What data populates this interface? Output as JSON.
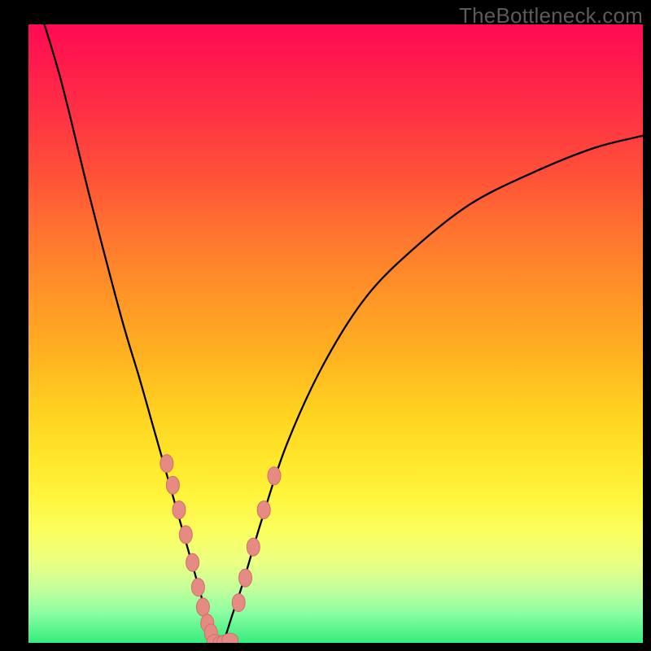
{
  "watermark": "TheBottleneck.com",
  "colors": {
    "frame": "#000000",
    "curve": "#000000",
    "marker_fill": "#e68a84",
    "marker_stroke": "#cf6f69"
  },
  "chart_data": {
    "type": "line",
    "title": "",
    "xlabel": "",
    "ylabel": "",
    "xlim": [
      0,
      100
    ],
    "ylim": [
      0,
      100
    ],
    "grid": false,
    "legend": false,
    "note": "Qualitative bottleneck curve; y is mismatch % (0 at minimum). Values estimated from pixels.",
    "x": [
      0,
      5,
      10,
      15,
      18,
      20,
      22,
      24,
      26,
      28,
      29,
      30,
      31,
      32,
      33,
      35,
      38,
      42,
      48,
      55,
      63,
      72,
      82,
      92,
      100
    ],
    "values": [
      108,
      92,
      72,
      53,
      43,
      36,
      29,
      22,
      15,
      8,
      4,
      1,
      0,
      1,
      4,
      10,
      20,
      32,
      45,
      56,
      64,
      71,
      76,
      80,
      82
    ],
    "markers": {
      "left_branch_x": [
        22.5,
        23.5,
        24.5,
        25.6,
        26.7,
        27.6,
        28.4,
        29.1,
        29.7
      ],
      "left_branch_y": [
        29.0,
        25.5,
        21.5,
        17.5,
        13.0,
        9.0,
        5.8,
        3.2,
        1.6
      ],
      "bottom_x": [
        30.4,
        31.4,
        32.0,
        32.8
      ],
      "bottom_y": [
        0.3,
        0.1,
        0.2,
        0.5
      ],
      "right_branch_x": [
        34.2,
        35.3,
        36.6,
        38.3,
        40.0
      ],
      "right_branch_y": [
        6.5,
        10.5,
        15.5,
        21.5,
        27.0
      ]
    }
  }
}
